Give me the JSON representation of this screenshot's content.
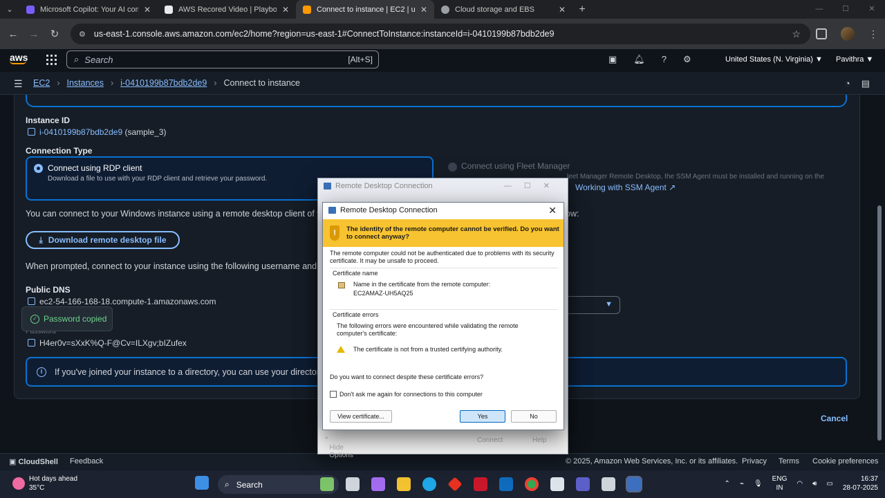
{
  "browser": {
    "tabs": [
      {
        "title": "Microsoft Copilot: Your AI comp",
        "color": "#7b5cff"
      },
      {
        "title": "AWS Recored Video | Playbook",
        "color": "#ffffff"
      },
      {
        "title": "Connect to instance | EC2 | us-e",
        "color": "#ff9900"
      },
      {
        "title": "Cloud storage and EBS",
        "color": "#9aa0a6"
      }
    ],
    "url": "us-east-1.console.aws.amazon.com/ec2/home?region=us-east-1#ConnectToInstance:instanceId=i-0410199b87bdb2de9"
  },
  "aws_header": {
    "logo": "aws",
    "search_placeholder": "Search",
    "search_shortcut": "[Alt+S]",
    "region": "United States (N. Virginia) ▼",
    "user": "Pavithra ▼"
  },
  "breadcrumb": {
    "items": [
      "EC2",
      "Instances",
      "i-0410199b87bdb2de9"
    ],
    "current": "Connect to instance"
  },
  "content": {
    "instance_id_label": "Instance ID",
    "instance_id": "i-0410199b87bdb2de9",
    "instance_name": "(sample_3)",
    "connection_type_label": "Connection Type",
    "rdp_option": "Connect using RDP client",
    "rdp_desc": "Download a file to use with your RDP client and retrieve your password.",
    "fleet_option": "Connect using Fleet Manager",
    "fleet_desc": "leet Manager Remote Desktop, the SSM Agent must be installed and running on the",
    "ssm_link": "Working with SSM Agent",
    "connect_text": "You can connect to your Windows instance using a remote desktop client of you",
    "connect_text_tail": "ow:",
    "download_button": "Download remote desktop file",
    "prompt_text": "When prompted, connect to your instance using the following username and pa",
    "public_dns_label": "Public DNS",
    "public_dns": "ec2-54-166-168-18.compute-1.amazonaws.com",
    "toast": "Password copied",
    "password_label": "Password",
    "password": "H4er0v=sXxK%Q-F@Cv=ILXgv;bIZufex",
    "info_text": "If you've joined your instance to a directory, you can use your directory cr",
    "cancel": "Cancel"
  },
  "footer": {
    "cloudshell": "CloudShell",
    "feedback": "Feedback",
    "copyright": "© 2025, Amazon Web Services, Inc. or its affiliates.",
    "privacy": "Privacy",
    "terms": "Terms",
    "cookies": "Cookie preferences"
  },
  "rdp_back": {
    "title": "Remote Desktop Connection",
    "hide_options": "Hide Options",
    "connect": "Connect",
    "help": "Help"
  },
  "rdp_dialog": {
    "title": "Remote Desktop Connection",
    "warning": "The identity of the remote computer cannot be verified. Do you want to connect anyway?",
    "desc": "The remote computer could not be authenticated due to problems with its security certificate. It may be unsafe to proceed.",
    "cert_name_label": "Certificate name",
    "cert_name_text": "Name in the certificate from the remote computer:",
    "cert_name_value": "EC2AMAZ-UH5AQ25",
    "cert_errors_label": "Certificate errors",
    "cert_errors_text": "The following errors were encountered while validating the remote computer's certificate:",
    "cert_error": "The certificate is not from a trusted certifying authority.",
    "question": "Do you want to connect despite these certificate errors?",
    "dont_ask": "Don't ask me again for connections to this computer",
    "view_cert": "View certificate...",
    "yes": "Yes",
    "no": "No"
  },
  "taskbar": {
    "weather_title": "Hot days ahead",
    "weather_temp": "35°C",
    "search": "Search",
    "lang1": "ENG",
    "lang2": "IN",
    "time": "16:37",
    "date": "28-07-2025"
  }
}
